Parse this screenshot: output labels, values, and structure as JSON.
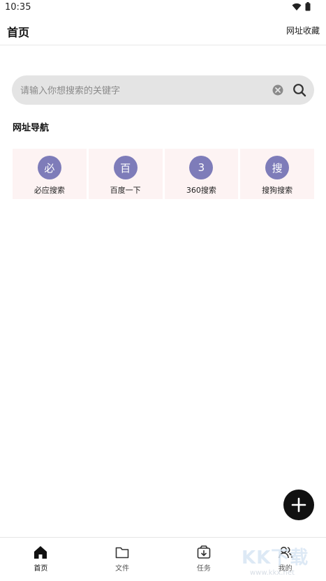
{
  "status_bar": {
    "time": "10:35"
  },
  "app_bar": {
    "title": "首页",
    "bookmarks_label": "网址收藏"
  },
  "search": {
    "placeholder": "请输入你想搜索的关键字",
    "value": ""
  },
  "nav_section": {
    "title": "网址导航",
    "items": [
      {
        "badge": "必",
        "label": "必应搜索"
      },
      {
        "badge": "百",
        "label": "百度一下"
      },
      {
        "badge": "3",
        "label": "360搜索"
      },
      {
        "badge": "搜",
        "label": "搜狗搜索"
      }
    ]
  },
  "bottom_nav": {
    "items": [
      {
        "label": "首页",
        "icon": "home-icon",
        "active": true
      },
      {
        "label": "文件",
        "icon": "folder-icon",
        "active": false
      },
      {
        "label": "任务",
        "icon": "task-icon",
        "active": false
      },
      {
        "label": "我的",
        "icon": "profile-icon",
        "active": false
      }
    ]
  },
  "watermark": {
    "logo": "KK下载",
    "url": "www.kkx.net"
  },
  "colors": {
    "badge": "#7e7cb9",
    "tile_bg": "#fdf3f3",
    "search_bg": "#e4e4e4",
    "fab": "#111111"
  }
}
